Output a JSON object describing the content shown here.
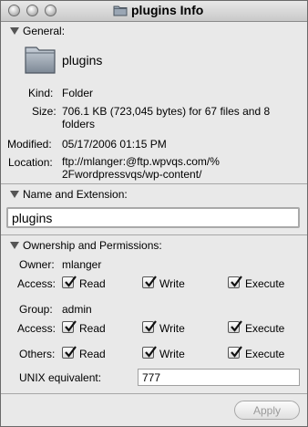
{
  "window": {
    "title": "plugins Info"
  },
  "general": {
    "section_label": "General:",
    "name": "plugins",
    "kind_label": "Kind:",
    "kind": "Folder",
    "size_label": "Size:",
    "size_line1": "706.1 KB (723,045 bytes) for 67 files and 8",
    "size_line2": "folders",
    "modified_label": "Modified:",
    "modified": "05/17/2006 01:15 PM",
    "location_label": "Location:",
    "location_line1": "ftp://mlanger:@ftp.wpvqs.com/%",
    "location_line2": "2Fwordpressvqs/wp-content/"
  },
  "name_extension": {
    "section_label": "Name and Extension:",
    "value": "plugins"
  },
  "ownership": {
    "section_label": "Ownership and Permissions:",
    "owner_label": "Owner:",
    "owner": "mlanger",
    "group_label": "Group:",
    "group": "admin",
    "access_label": "Access:",
    "others_label": "Others:",
    "read": "Read",
    "write": "Write",
    "execute": "Execute",
    "owner_perms": {
      "read": true,
      "write": true,
      "execute": true
    },
    "group_perms": {
      "read": true,
      "write": true,
      "execute": true
    },
    "others_perms": {
      "read": true,
      "write": true,
      "execute": true
    },
    "unix_label": "UNIX equivalent:",
    "unix_value": "777"
  },
  "footer": {
    "apply_label": "Apply"
  }
}
